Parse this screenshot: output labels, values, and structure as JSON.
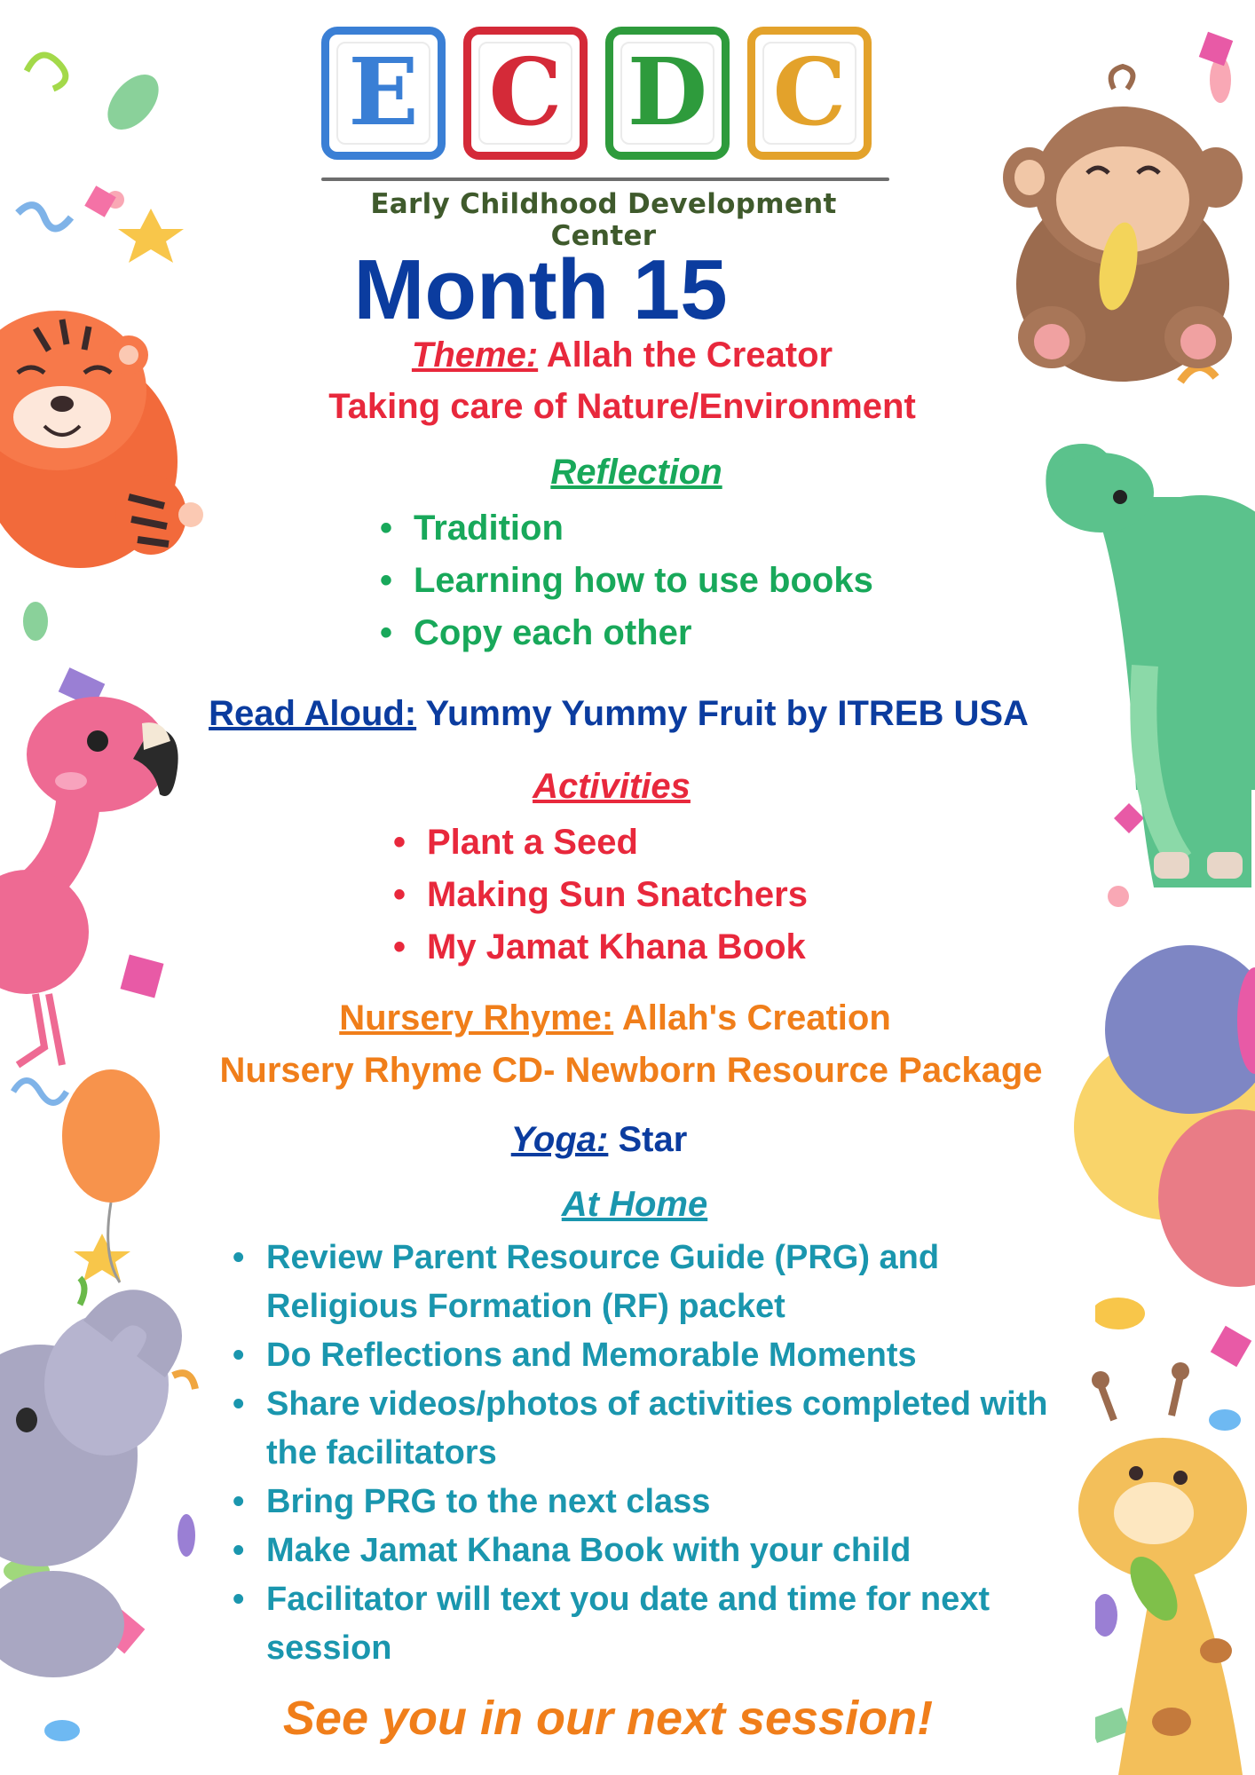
{
  "logo": {
    "letters": [
      {
        "char": "E",
        "color": "#3a7fd5"
      },
      {
        "char": "C",
        "color": "#d42a38"
      },
      {
        "char": "D",
        "color": "#2e9b3c"
      },
      {
        "char": "C",
        "color": "#e3a22b"
      }
    ],
    "tagline": "Early Childhood Development Center"
  },
  "title": "Month 15",
  "theme": {
    "label": "Theme:",
    "text": " Allah the Creator",
    "line2": "Taking care of Nature/Environment"
  },
  "reflection": {
    "heading": "Reflection",
    "items": [
      "Tradition",
      "Learning how to use books",
      "Copy each other"
    ]
  },
  "read_aloud": {
    "label": "Read Aloud:",
    "text": " Yummy Yummy Fruit by ITREB USA"
  },
  "activities": {
    "heading": "Activities",
    "items": [
      "Plant a Seed",
      "Making Sun Snatchers",
      "My Jamat Khana Book"
    ]
  },
  "nursery_rhyme": {
    "label": "Nursery Rhyme:",
    "text": " Allah's Creation",
    "line2": "Nursery Rhyme CD- Newborn Resource Package"
  },
  "yoga": {
    "label": "Yoga:",
    "text": " Star"
  },
  "at_home": {
    "heading": "At Home",
    "items": [
      "Review Parent Resource Guide (PRG) and Religious Formation (RF) packet",
      "Do Reflections and Memorable Moments",
      "Share videos/photos of activities completed with the facilitators",
      "Bring PRG to the next class",
      "Make Jamat Khana Book with your child",
      "Facilitator will text you date and time for next session"
    ]
  },
  "footer": "See you in our next session!",
  "illustrations": [
    "tiger-illustration",
    "flamingo-illustration",
    "elephant-illustration",
    "monkey-illustration",
    "dinosaur-illustration",
    "giraffe-illustration",
    "balloons-illustration",
    "confetti-decoration"
  ]
}
